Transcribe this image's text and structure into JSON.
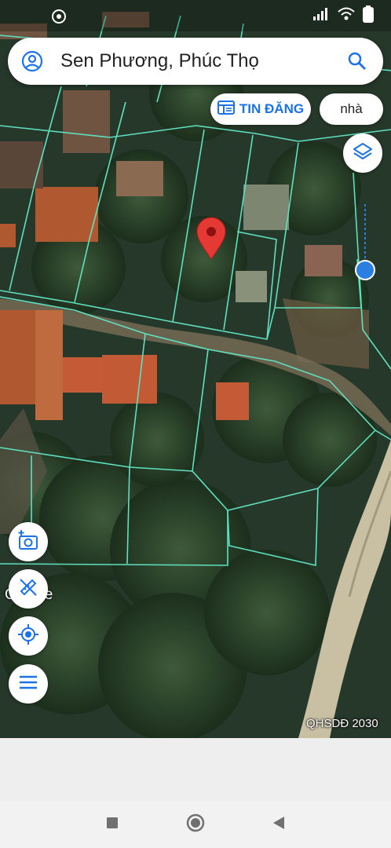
{
  "search": {
    "query": "Sen Phương, Phúc Thọ"
  },
  "chips": {
    "tin_dang": "TIN ĐĂNG",
    "nha": "nhà"
  },
  "map": {
    "attribution": "Google",
    "watermark": "QHSDĐ 2030"
  },
  "icons": {
    "status_left": "activity-icon",
    "signal": "signal-icon",
    "wifi": "wifi-icon",
    "battery": "battery-icon",
    "account": "account-circle-icon",
    "search": "search-icon",
    "news": "newspaper-icon",
    "layers": "layers-icon",
    "camera": "add-photo-icon",
    "ruler": "measure-icon",
    "locate": "my-location-icon",
    "menu": "menu-icon",
    "nav_recents": "square-icon",
    "nav_home": "circle-icon",
    "nav_back": "triangle-back-icon"
  },
  "colors": {
    "accent": "#1a73e8",
    "parcel_lines": "#5fe0c0",
    "pin": "#e53935",
    "location": "#2b7fe0"
  }
}
